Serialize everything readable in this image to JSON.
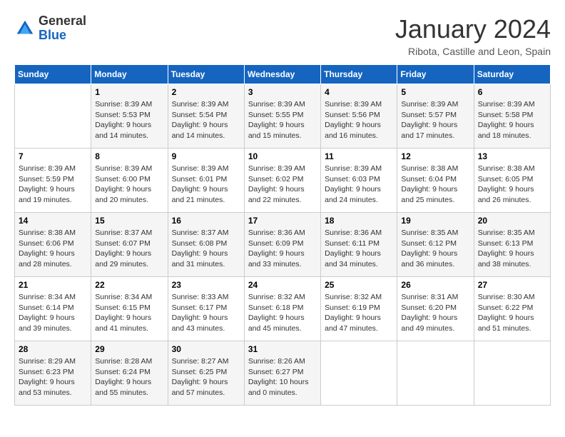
{
  "logo": {
    "general": "General",
    "blue": "Blue"
  },
  "header": {
    "month": "January 2024",
    "location": "Ribota, Castille and Leon, Spain"
  },
  "weekdays": [
    "Sunday",
    "Monday",
    "Tuesday",
    "Wednesday",
    "Thursday",
    "Friday",
    "Saturday"
  ],
  "weeks": [
    [
      {
        "day": "",
        "sunrise": "",
        "sunset": "",
        "daylight": ""
      },
      {
        "day": "1",
        "sunrise": "Sunrise: 8:39 AM",
        "sunset": "Sunset: 5:53 PM",
        "daylight": "Daylight: 9 hours and 14 minutes."
      },
      {
        "day": "2",
        "sunrise": "Sunrise: 8:39 AM",
        "sunset": "Sunset: 5:54 PM",
        "daylight": "Daylight: 9 hours and 14 minutes."
      },
      {
        "day": "3",
        "sunrise": "Sunrise: 8:39 AM",
        "sunset": "Sunset: 5:55 PM",
        "daylight": "Daylight: 9 hours and 15 minutes."
      },
      {
        "day": "4",
        "sunrise": "Sunrise: 8:39 AM",
        "sunset": "Sunset: 5:56 PM",
        "daylight": "Daylight: 9 hours and 16 minutes."
      },
      {
        "day": "5",
        "sunrise": "Sunrise: 8:39 AM",
        "sunset": "Sunset: 5:57 PM",
        "daylight": "Daylight: 9 hours and 17 minutes."
      },
      {
        "day": "6",
        "sunrise": "Sunrise: 8:39 AM",
        "sunset": "Sunset: 5:58 PM",
        "daylight": "Daylight: 9 hours and 18 minutes."
      }
    ],
    [
      {
        "day": "7",
        "sunrise": "Sunrise: 8:39 AM",
        "sunset": "Sunset: 5:59 PM",
        "daylight": "Daylight: 9 hours and 19 minutes."
      },
      {
        "day": "8",
        "sunrise": "Sunrise: 8:39 AM",
        "sunset": "Sunset: 6:00 PM",
        "daylight": "Daylight: 9 hours and 20 minutes."
      },
      {
        "day": "9",
        "sunrise": "Sunrise: 8:39 AM",
        "sunset": "Sunset: 6:01 PM",
        "daylight": "Daylight: 9 hours and 21 minutes."
      },
      {
        "day": "10",
        "sunrise": "Sunrise: 8:39 AM",
        "sunset": "Sunset: 6:02 PM",
        "daylight": "Daylight: 9 hours and 22 minutes."
      },
      {
        "day": "11",
        "sunrise": "Sunrise: 8:39 AM",
        "sunset": "Sunset: 6:03 PM",
        "daylight": "Daylight: 9 hours and 24 minutes."
      },
      {
        "day": "12",
        "sunrise": "Sunrise: 8:38 AM",
        "sunset": "Sunset: 6:04 PM",
        "daylight": "Daylight: 9 hours and 25 minutes."
      },
      {
        "day": "13",
        "sunrise": "Sunrise: 8:38 AM",
        "sunset": "Sunset: 6:05 PM",
        "daylight": "Daylight: 9 hours and 26 minutes."
      }
    ],
    [
      {
        "day": "14",
        "sunrise": "Sunrise: 8:38 AM",
        "sunset": "Sunset: 6:06 PM",
        "daylight": "Daylight: 9 hours and 28 minutes."
      },
      {
        "day": "15",
        "sunrise": "Sunrise: 8:37 AM",
        "sunset": "Sunset: 6:07 PM",
        "daylight": "Daylight: 9 hours and 29 minutes."
      },
      {
        "day": "16",
        "sunrise": "Sunrise: 8:37 AM",
        "sunset": "Sunset: 6:08 PM",
        "daylight": "Daylight: 9 hours and 31 minutes."
      },
      {
        "day": "17",
        "sunrise": "Sunrise: 8:36 AM",
        "sunset": "Sunset: 6:09 PM",
        "daylight": "Daylight: 9 hours and 33 minutes."
      },
      {
        "day": "18",
        "sunrise": "Sunrise: 8:36 AM",
        "sunset": "Sunset: 6:11 PM",
        "daylight": "Daylight: 9 hours and 34 minutes."
      },
      {
        "day": "19",
        "sunrise": "Sunrise: 8:35 AM",
        "sunset": "Sunset: 6:12 PM",
        "daylight": "Daylight: 9 hours and 36 minutes."
      },
      {
        "day": "20",
        "sunrise": "Sunrise: 8:35 AM",
        "sunset": "Sunset: 6:13 PM",
        "daylight": "Daylight: 9 hours and 38 minutes."
      }
    ],
    [
      {
        "day": "21",
        "sunrise": "Sunrise: 8:34 AM",
        "sunset": "Sunset: 6:14 PM",
        "daylight": "Daylight: 9 hours and 39 minutes."
      },
      {
        "day": "22",
        "sunrise": "Sunrise: 8:34 AM",
        "sunset": "Sunset: 6:15 PM",
        "daylight": "Daylight: 9 hours and 41 minutes."
      },
      {
        "day": "23",
        "sunrise": "Sunrise: 8:33 AM",
        "sunset": "Sunset: 6:17 PM",
        "daylight": "Daylight: 9 hours and 43 minutes."
      },
      {
        "day": "24",
        "sunrise": "Sunrise: 8:32 AM",
        "sunset": "Sunset: 6:18 PM",
        "daylight": "Daylight: 9 hours and 45 minutes."
      },
      {
        "day": "25",
        "sunrise": "Sunrise: 8:32 AM",
        "sunset": "Sunset: 6:19 PM",
        "daylight": "Daylight: 9 hours and 47 minutes."
      },
      {
        "day": "26",
        "sunrise": "Sunrise: 8:31 AM",
        "sunset": "Sunset: 6:20 PM",
        "daylight": "Daylight: 9 hours and 49 minutes."
      },
      {
        "day": "27",
        "sunrise": "Sunrise: 8:30 AM",
        "sunset": "Sunset: 6:22 PM",
        "daylight": "Daylight: 9 hours and 51 minutes."
      }
    ],
    [
      {
        "day": "28",
        "sunrise": "Sunrise: 8:29 AM",
        "sunset": "Sunset: 6:23 PM",
        "daylight": "Daylight: 9 hours and 53 minutes."
      },
      {
        "day": "29",
        "sunrise": "Sunrise: 8:28 AM",
        "sunset": "Sunset: 6:24 PM",
        "daylight": "Daylight: 9 hours and 55 minutes."
      },
      {
        "day": "30",
        "sunrise": "Sunrise: 8:27 AM",
        "sunset": "Sunset: 6:25 PM",
        "daylight": "Daylight: 9 hours and 57 minutes."
      },
      {
        "day": "31",
        "sunrise": "Sunrise: 8:26 AM",
        "sunset": "Sunset: 6:27 PM",
        "daylight": "Daylight: 10 hours and 0 minutes."
      },
      {
        "day": "",
        "sunrise": "",
        "sunset": "",
        "daylight": ""
      },
      {
        "day": "",
        "sunrise": "",
        "sunset": "",
        "daylight": ""
      },
      {
        "day": "",
        "sunrise": "",
        "sunset": "",
        "daylight": ""
      }
    ]
  ]
}
